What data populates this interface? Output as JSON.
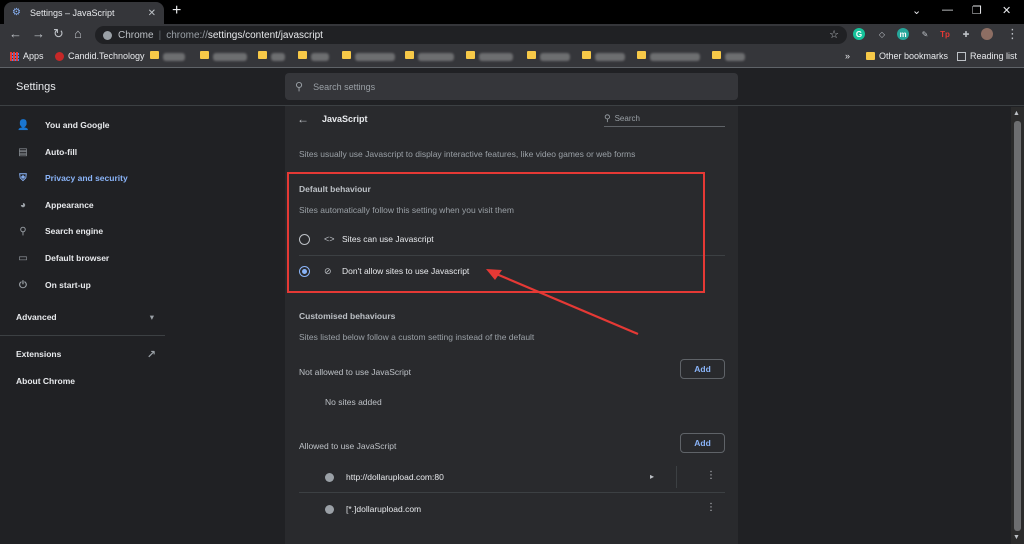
{
  "browser": {
    "tab_title": "Settings – JavaScript",
    "tab_close": "✕",
    "new_tab": "+",
    "window_controls": [
      "⌄",
      "—",
      "❐",
      "✕"
    ],
    "omnibox": {
      "site_label": "Chrome",
      "separator": "|",
      "url_scheme": "chrome://",
      "url_path": "settings/content/javascript"
    },
    "extensions": [
      {
        "name": "grammarly",
        "glyph": "G",
        "color": "#15c39a"
      },
      {
        "name": "tab-ext",
        "glyph": "◇",
        "color": "#5f6368"
      },
      {
        "name": "m-ext",
        "glyph": "m",
        "color": "#26a69a"
      },
      {
        "name": "pen-ext",
        "glyph": "✎",
        "color": "#5f6368"
      },
      {
        "name": "tp-ext",
        "glyph": "Tp",
        "color": "#e53935"
      },
      {
        "name": "puzzle",
        "glyph": "✚",
        "color": "#5f6368"
      }
    ]
  },
  "bookmarks": {
    "apps": "Apps",
    "candid": "Candid.Technology",
    "more": "»",
    "other": "Other bookmarks",
    "reading_list": "Reading list"
  },
  "settings": {
    "title": "Settings",
    "search_placeholder": "Search settings"
  },
  "sidebar": {
    "items": [
      {
        "label": "You and Google",
        "icon": "person-icon",
        "glyph": "👤"
      },
      {
        "label": "Auto-fill",
        "icon": "clipboard-icon",
        "glyph": "▤"
      },
      {
        "label": "Privacy and security",
        "icon": "shield-icon",
        "glyph": "⛨"
      },
      {
        "label": "Appearance",
        "icon": "palette-icon",
        "glyph": "◕"
      },
      {
        "label": "Search engine",
        "icon": "search-icon",
        "glyph": "⚲"
      },
      {
        "label": "Default browser",
        "icon": "browser-icon",
        "glyph": "▭"
      },
      {
        "label": "On start-up",
        "icon": "power-icon",
        "glyph": "⏻"
      }
    ],
    "advanced": "Advanced",
    "advanced_arrow": "▾",
    "extensions": "Extensions",
    "extensions_link": "↗",
    "about": "About Chrome"
  },
  "page": {
    "back_arrow": "←",
    "title": "JavaScript",
    "search_placeholder": "Search",
    "description": "Sites usually use Javascript to display interactive features, like video games or web forms",
    "default_heading": "Default behaviour",
    "default_sub": "Sites automatically follow this setting when you visit them",
    "option_allow": "Sites can use Javascript",
    "option_allow_icon": "<>",
    "option_block": "Don't allow sites to use Javascript",
    "option_block_icon": "⊘",
    "custom_heading": "Customised behaviours",
    "custom_sub": "Sites listed below follow a custom setting instead of the default",
    "not_allowed_label": "Not allowed to use JavaScript",
    "add_label": "Add",
    "no_sites": "No sites added",
    "allowed_label": "Allowed to use JavaScript",
    "allowed_sites": [
      {
        "url": "http://dollarupload.com:80",
        "has_chevron": true
      },
      {
        "url": "[*.]dollarupload.com",
        "has_chevron": false
      }
    ],
    "chevron": "▸",
    "kebab": "⋮"
  },
  "colors": {
    "accent": "#8ab4f8",
    "annotation": "#e53935"
  }
}
